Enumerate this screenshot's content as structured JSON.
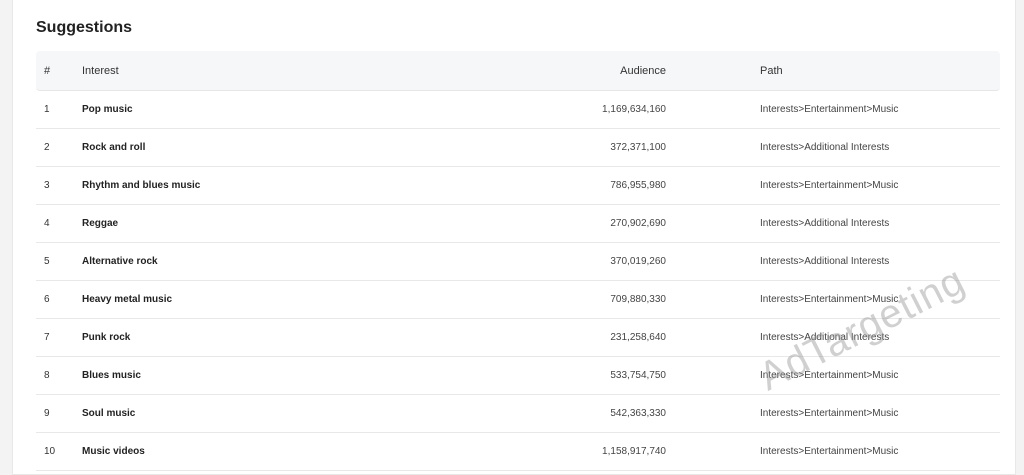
{
  "section": {
    "title": "Suggestions"
  },
  "table": {
    "headers": {
      "num": "#",
      "interest": "Interest",
      "audience": "Audience",
      "path": "Path"
    },
    "rows": [
      {
        "num": "1",
        "interest": "Pop music",
        "audience": "1,169,634,160",
        "path": "Interests>Entertainment>Music"
      },
      {
        "num": "2",
        "interest": "Rock and roll",
        "audience": "372,371,100",
        "path": "Interests>Additional Interests"
      },
      {
        "num": "3",
        "interest": "Rhythm and blues music",
        "audience": "786,955,980",
        "path": "Interests>Entertainment>Music"
      },
      {
        "num": "4",
        "interest": "Reggae",
        "audience": "270,902,690",
        "path": "Interests>Additional Interests"
      },
      {
        "num": "5",
        "interest": "Alternative rock",
        "audience": "370,019,260",
        "path": "Interests>Additional Interests"
      },
      {
        "num": "6",
        "interest": "Heavy metal music",
        "audience": "709,880,330",
        "path": "Interests>Entertainment>Music"
      },
      {
        "num": "7",
        "interest": "Punk rock",
        "audience": "231,258,640",
        "path": "Interests>Additional Interests"
      },
      {
        "num": "8",
        "interest": "Blues music",
        "audience": "533,754,750",
        "path": "Interests>Entertainment>Music"
      },
      {
        "num": "9",
        "interest": "Soul music",
        "audience": "542,363,330",
        "path": "Interests>Entertainment>Music"
      },
      {
        "num": "10",
        "interest": "Music videos",
        "audience": "1,158,917,740",
        "path": "Interests>Entertainment>Music"
      }
    ]
  },
  "watermark": "AdTargeting",
  "colors": {
    "header_bg": "#f6f7f9",
    "border": "#e8e8e8",
    "text": "#222222"
  }
}
